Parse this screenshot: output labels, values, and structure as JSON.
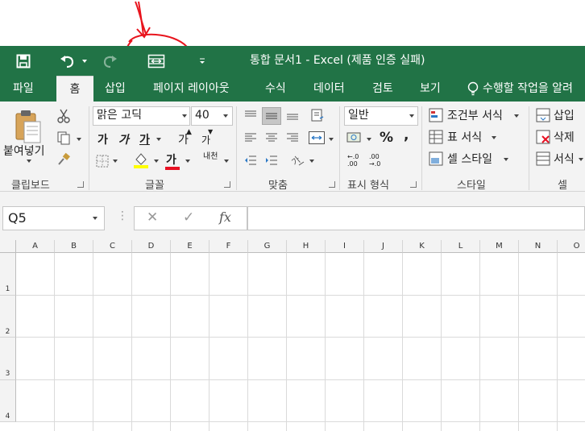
{
  "title_bar": {
    "title": "통합 문서1 - Excel (제품 인증 실패)",
    "icons": [
      "save-icon",
      "undo-icon",
      "redo-icon",
      "merge-center-icon",
      "customize-qat-icon"
    ]
  },
  "tabs": [
    "파일",
    "홈",
    "삽입",
    "페이지 레이아웃",
    "수식",
    "데이터",
    "검토",
    "보기"
  ],
  "active_tab": "홈",
  "tell_me": "수행할 작업을 알려",
  "clipboard": {
    "paste_label": "붙여넣기",
    "group_label": "클립보드"
  },
  "font": {
    "font_name": "맑은 고딕",
    "font_size": "40",
    "bold": "가",
    "italic": "가",
    "underline": "가",
    "grow": "가",
    "shrink": "가",
    "color_glyph": "가",
    "phonetic": "내천",
    "group_label": "글꼴"
  },
  "alignment": {
    "group_label": "맞춤"
  },
  "number": {
    "format": "일반",
    "percent": "%",
    "comma": ",",
    "increase_decimal": "←.0 .00",
    "decrease_decimal": ".00 →.0",
    "group_label": "표시 형식"
  },
  "styles": {
    "conditional": "조건부 서식",
    "table": "표 서식",
    "cell_styles": "셀 스타일",
    "group_label": "스타일"
  },
  "cells": {
    "insert": "삽입",
    "delete": "삭제",
    "format": "서식",
    "group_label": "셀"
  },
  "formula_bar": {
    "name_box": "Q5",
    "fx": "fx",
    "cancel": "✕",
    "enter": "✓",
    "formula": ""
  },
  "grid": {
    "columns": [
      "A",
      "B",
      "C",
      "D",
      "E",
      "F",
      "G",
      "H",
      "I",
      "J",
      "K",
      "L",
      "M",
      "N",
      "O"
    ],
    "rows": [
      "1",
      "2",
      "3",
      "4"
    ]
  },
  "colors": {
    "excel_green": "#217346",
    "annotation_red": "#e8141d"
  }
}
